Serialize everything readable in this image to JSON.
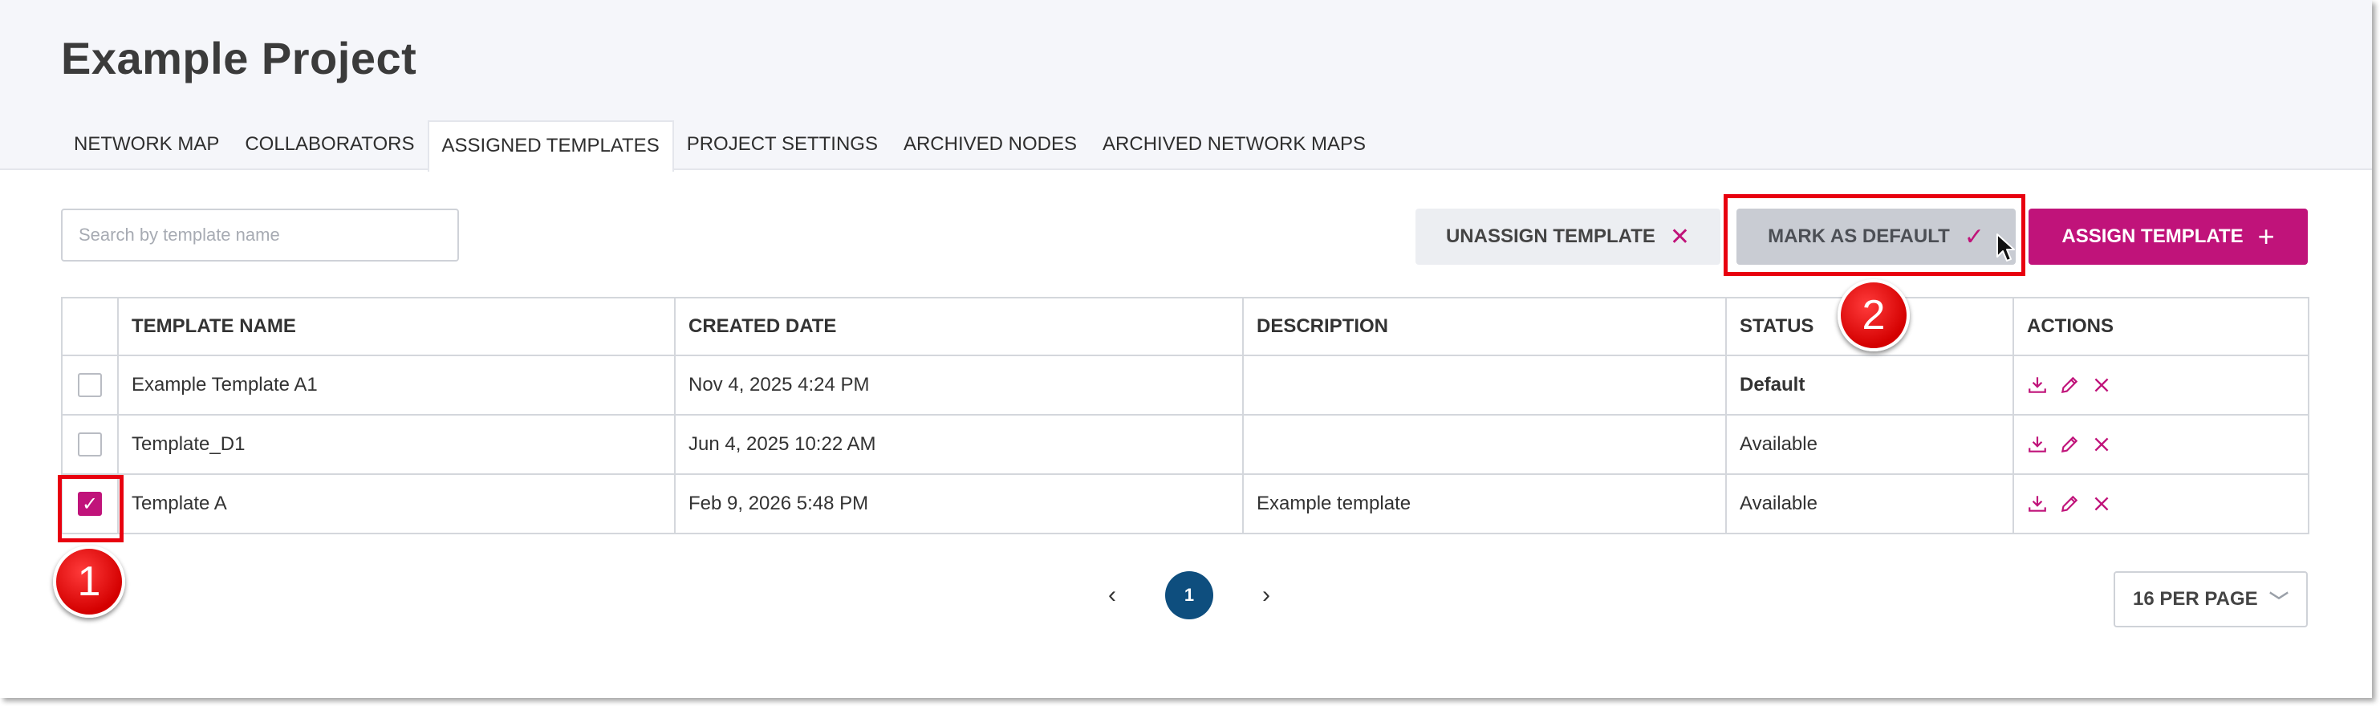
{
  "project": {
    "title": "Example Project"
  },
  "tabs": [
    {
      "label": "NETWORK MAP",
      "active": false
    },
    {
      "label": "COLLABORATORS",
      "active": false
    },
    {
      "label": "ASSIGNED TEMPLATES",
      "active": true
    },
    {
      "label": "PROJECT SETTINGS",
      "active": false
    },
    {
      "label": "ARCHIVED NODES",
      "active": false
    },
    {
      "label": "ARCHIVED NETWORK MAPS",
      "active": false
    }
  ],
  "search": {
    "placeholder": "Search by template name",
    "value": ""
  },
  "toolbar": {
    "unassign_label": "UNASSIGN TEMPLATE",
    "unassign_icon": "close-icon",
    "mark_default_label": "MARK AS DEFAULT",
    "mark_default_icon": "check-icon",
    "assign_label": "ASSIGN TEMPLATE",
    "assign_icon": "plus-icon"
  },
  "table": {
    "columns": [
      "TEMPLATE NAME",
      "CREATED DATE",
      "DESCRIPTION",
      "STATUS",
      "ACTIONS"
    ],
    "rows": [
      {
        "checked": false,
        "name": "Example Template A1",
        "created": "Nov 4, 2025 4:24 PM",
        "description": "",
        "status": "Default"
      },
      {
        "checked": false,
        "name": "Template_D1",
        "created": "Jun 4, 2025 10:22 AM",
        "description": "",
        "status": "Available"
      },
      {
        "checked": true,
        "name": "Template A",
        "created": "Feb 9, 2026 5:48 PM",
        "description": "Example template",
        "status": "Available"
      }
    ],
    "row_actions": [
      "download-icon",
      "edit-icon",
      "delete-icon"
    ]
  },
  "pagination": {
    "current_page": "1",
    "per_page_label": "16 PER PAGE"
  },
  "annotations": [
    {
      "number": "1",
      "target": "row-3-checkbox"
    },
    {
      "number": "2",
      "target": "mark-as-default-button"
    }
  ],
  "colors": {
    "accent": "#c0137a",
    "page_badge": "#0e4e7e",
    "annotation_red": "#e8000f"
  }
}
